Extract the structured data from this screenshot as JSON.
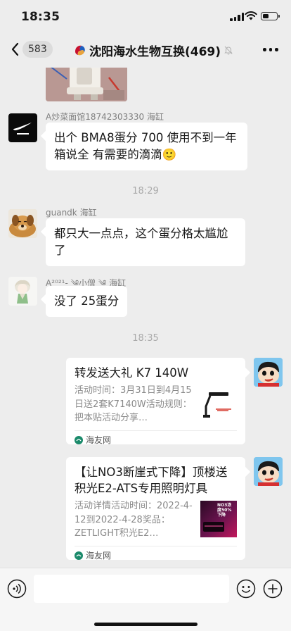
{
  "status_bar": {
    "time": "18:35"
  },
  "navbar": {
    "unread_count": "583",
    "title": "沈阳海水生物互换(469)"
  },
  "messages": [
    {
      "sender": "A炒菜面馆18742303330 海缸",
      "text": "出个 BMA8蛋分 700 使用不到一年 箱说全 有需要的滴滴🙂"
    },
    {
      "sender": "guandk 海缸",
      "text": "都只大一点点，这个蛋分格太尴尬了"
    },
    {
      "sender": "A²⁰²¹-  ༄小僧 ༄  海缸",
      "text": "没了 25蛋分"
    }
  ],
  "timestamps": [
    "18:29",
    "18:35"
  ],
  "cards": [
    {
      "title": "转发送大礼 K7 140W",
      "desc": "活动时间：3月31日到4月15日送2套K7140W活动规则：把本贴活动分享…",
      "source": "海友网"
    },
    {
      "title": "【让NO3断崖式下降】顶楼送积光E2-ATS专用照明灯具",
      "desc": "活动详情活动时间：2022-4-12到2022-4-28奖品：ZETLIGHT积光E2…",
      "source": "海友网",
      "thumb_text": "NO3浓度50%下降"
    }
  ],
  "colors": {
    "background": "#ededed",
    "bubble": "#ffffff",
    "link_source": "#07c160"
  }
}
